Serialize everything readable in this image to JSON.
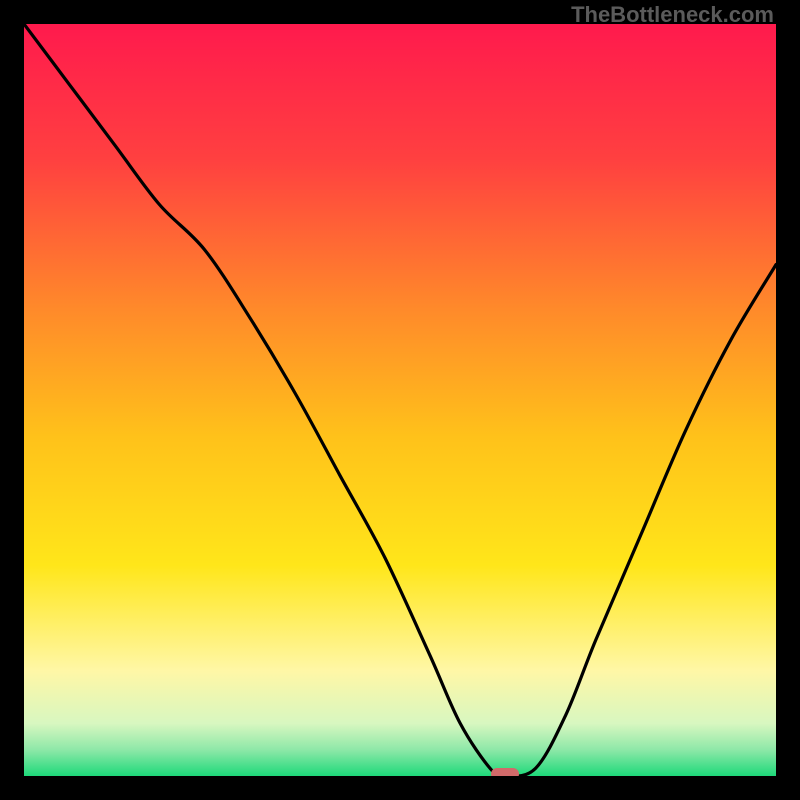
{
  "watermark": "TheBottleneck.com",
  "colors": {
    "frame": "#000000",
    "curve": "#000000",
    "marker": "#d16a6a",
    "gradient_stops": [
      {
        "offset": 0.0,
        "color": "#ff1a4d"
      },
      {
        "offset": 0.18,
        "color": "#ff4040"
      },
      {
        "offset": 0.38,
        "color": "#ff8a2a"
      },
      {
        "offset": 0.55,
        "color": "#ffc21a"
      },
      {
        "offset": 0.72,
        "color": "#ffe61a"
      },
      {
        "offset": 0.86,
        "color": "#fff7a6"
      },
      {
        "offset": 0.93,
        "color": "#d8f7c0"
      },
      {
        "offset": 0.965,
        "color": "#8ee8a8"
      },
      {
        "offset": 1.0,
        "color": "#1ed97a"
      }
    ]
  },
  "chart_data": {
    "type": "line",
    "title": "",
    "xlabel": "",
    "ylabel": "",
    "xlim": [
      0,
      100
    ],
    "ylim": [
      0,
      100
    ],
    "grid": false,
    "legend": false,
    "series": [
      {
        "name": "bottleneck-curve",
        "x": [
          0,
          6,
          12,
          18,
          24,
          30,
          36,
          42,
          48,
          54,
          58,
          62,
          64,
          68,
          72,
          76,
          82,
          88,
          94,
          100
        ],
        "y": [
          100,
          92,
          84,
          76,
          70,
          61,
          51,
          40,
          29,
          16,
          7,
          1,
          0,
          1,
          8,
          18,
          32,
          46,
          58,
          68
        ]
      }
    ],
    "marker": {
      "x": 64,
      "y": 0
    },
    "annotations": [
      {
        "text": "TheBottleneck.com",
        "position": "top-right"
      }
    ]
  }
}
